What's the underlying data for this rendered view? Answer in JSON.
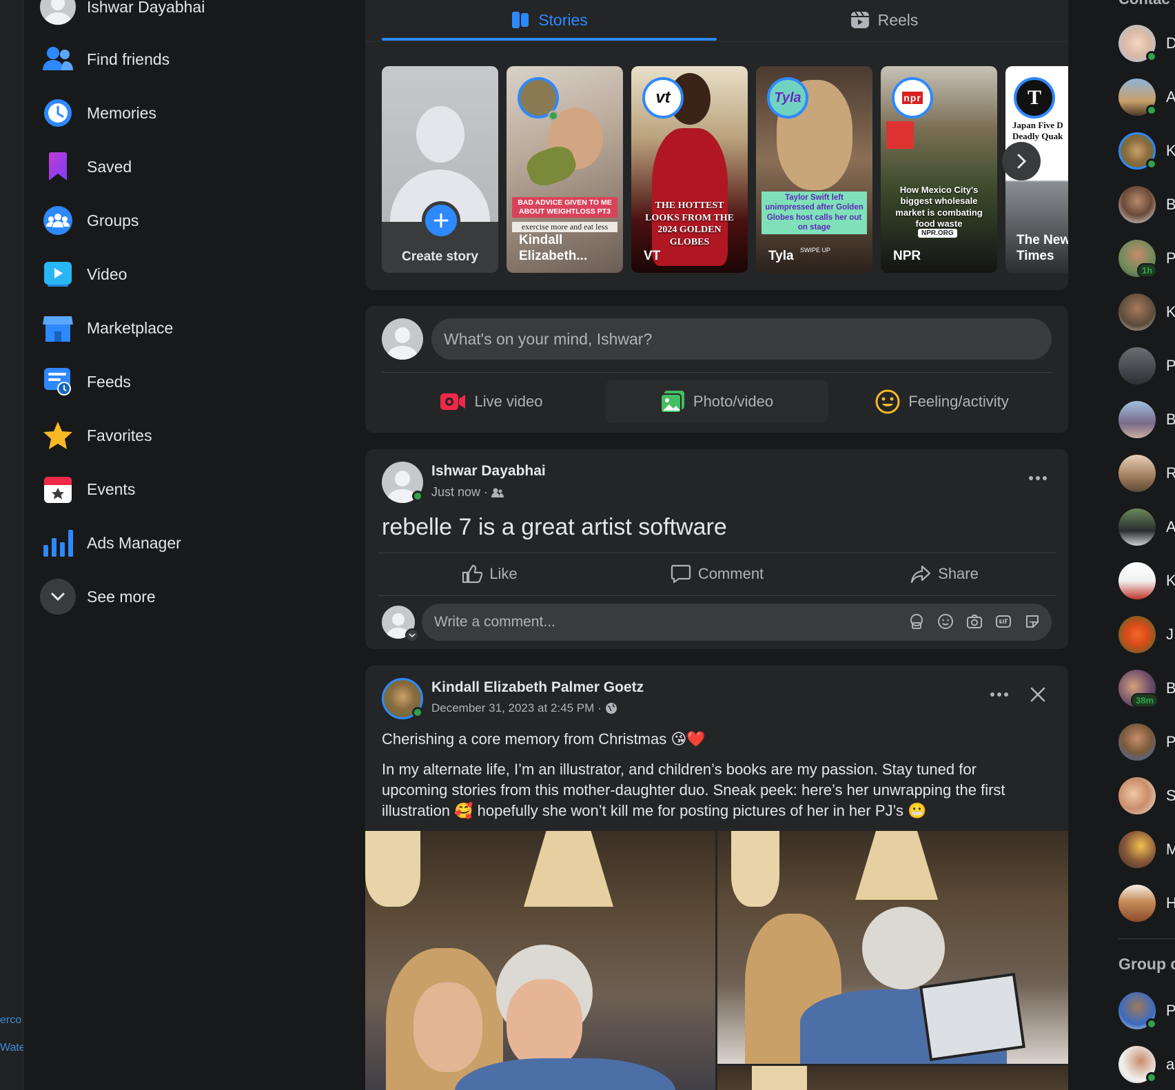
{
  "user": {
    "name": "Ishwar Dayabhai"
  },
  "sidebar": {
    "items": [
      {
        "label": "Find friends",
        "icon": "friends-icon"
      },
      {
        "label": "Memories",
        "icon": "memories-clock-icon"
      },
      {
        "label": "Saved",
        "icon": "bookmark-icon"
      },
      {
        "label": "Groups",
        "icon": "groups-icon"
      },
      {
        "label": "Video",
        "icon": "video-play-icon"
      },
      {
        "label": "Marketplace",
        "icon": "shop-icon"
      },
      {
        "label": "Feeds",
        "icon": "feeds-icon"
      },
      {
        "label": "Favorites",
        "icon": "star-icon"
      },
      {
        "label": "Events",
        "icon": "calendar-icon"
      },
      {
        "label": "Ads Manager",
        "icon": "bar-chart-icon"
      },
      {
        "label": "See more",
        "icon": "chevron-down-icon"
      }
    ]
  },
  "edge": {
    "line1": "erco",
    "line2": "Wate"
  },
  "tabs": {
    "stories": "Stories",
    "reels": "Reels"
  },
  "stories": [
    {
      "name": "Create story"
    },
    {
      "name": "Kindall Elizabeth...",
      "caption_top": "BAD ADVICE GIVEN TO ME ABOUT WEIGHTLOSS PT3",
      "caption_bottom": "exercise more and eat less"
    },
    {
      "name": "VT",
      "ring_text": "vt",
      "caption": "THE HOTTEST LOOKS FROM THE 2024 GOLDEN GLOBES"
    },
    {
      "name": "Tyla",
      "ring_text": "Tyla",
      "caption": "Taylor Swift left unimpressed after Golden Globes host calls her out on stage",
      "swipe": "SWIPE UP"
    },
    {
      "name": "NPR",
      "ring_text": "npr",
      "caption": "How Mexico City's biggest wholesale market is combating food waste",
      "badge": "NPR.ORG"
    },
    {
      "name": "The New York Times",
      "name_short": "The New Times",
      "ring_text": "T",
      "caption": "Japan Five D Deadly Quak"
    }
  ],
  "composer": {
    "placeholder": "What's on your mind, Ishwar?",
    "live": "Live video",
    "photo": "Photo/video",
    "feeling": "Feeling/activity"
  },
  "post1": {
    "author": "Ishwar Dayabhai",
    "time": "Just now",
    "text": "rebelle 7 is a great artist software",
    "like": "Like",
    "comment": "Comment",
    "share": "Share",
    "comment_placeholder": "Write a comment..."
  },
  "post2": {
    "author": "Kindall Elizabeth Palmer Goetz",
    "time": "December 31, 2023 at 2:45 PM",
    "line1": "Cherishing a core memory from Christmas 😘❤️",
    "line2": "In my alternate life, I’m an illustrator, and children’s books are my passion. Stay tuned for upcoming stories from this mother-daughter duo. Sneak peek: here’s her unwrapping the first illustration 🥰 hopefully she won’t kill me for posting pictures of her in her PJ’s 😬"
  },
  "contacts": {
    "header": "Contac",
    "letters": [
      "D",
      "A",
      "K",
      "B",
      "P",
      "K",
      "P",
      "B",
      "R",
      "A",
      "K",
      "J",
      "B",
      "P",
      "S",
      "M",
      "H"
    ],
    "badges": {
      "p": "1h",
      "b": "38m"
    },
    "group_header": "Group c",
    "group_letters": [
      "P",
      "a"
    ]
  },
  "colors": {
    "accent": "#2e89ff",
    "background": "#18191a",
    "card": "#242526",
    "online": "#31a24c"
  }
}
